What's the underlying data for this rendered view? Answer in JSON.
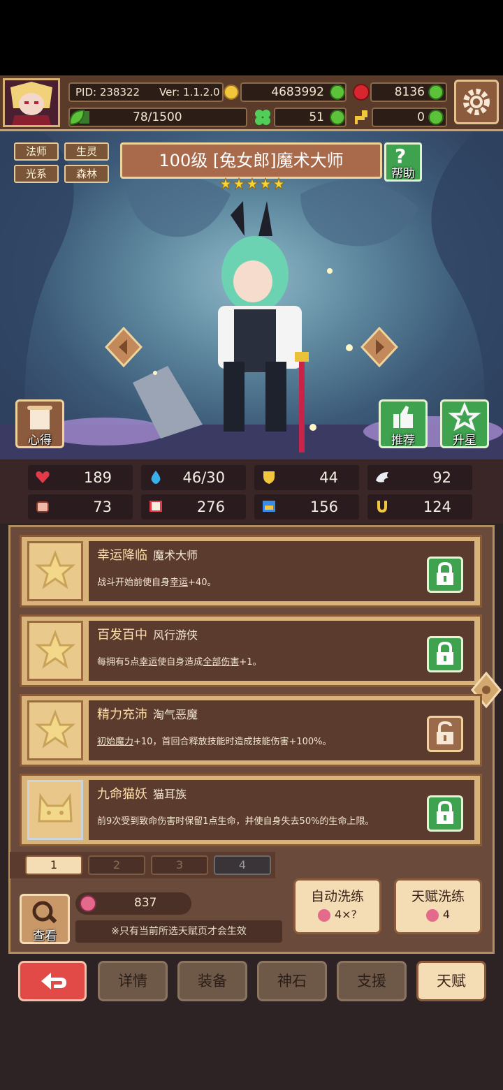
{
  "header": {
    "pid": "PID: 238322",
    "version": "Ver: 1.1.2.0",
    "gold": "4683992",
    "gems": "8136",
    "xp": "78/1500",
    "clover": "51",
    "key": "0"
  },
  "hero": {
    "tags": [
      "法师",
      "生灵",
      "光系",
      "森林"
    ],
    "title": "100级  [兔女郎]魔术大师",
    "help_label": "帮助",
    "notes_label": "心得",
    "recommend_label": "推荐",
    "upgrade_label": "升星"
  },
  "stats": [
    "189",
    "46/30",
    "44",
    "92",
    "73",
    "276",
    "156",
    "124"
  ],
  "talents": [
    {
      "name": "幸运降临",
      "sub": "魔术大师",
      "desc_a": "战斗开始前使自身",
      "desc_u1": "幸运",
      "desc_b": "+40。",
      "desc_u2": "",
      "desc_c": "",
      "lock": "locked-green"
    },
    {
      "name": "百发百中",
      "sub": "风行游侠",
      "desc_a": "每拥有5点",
      "desc_u1": "幸运",
      "desc_b": "使自身造成",
      "desc_u2": "全部伤害",
      "desc_c": "+1。",
      "lock": "locked-green"
    },
    {
      "name": "精力充沛",
      "sub": "淘气恶魔",
      "desc_a": "",
      "desc_u1": "初始魔力",
      "desc_b": "+10，首回合释放技能时造成技能伤害+100%。",
      "desc_u2": "",
      "desc_c": "",
      "lock": "unlocked-brown"
    },
    {
      "name": "九命猫妖",
      "sub": "猫耳族",
      "desc_a": "前9次受到致命伤害时保留1点生命，并使自身失去50%的生命上限。",
      "desc_u1": "",
      "desc_b": "",
      "desc_u2": "",
      "desc_c": "",
      "lock": "locked-green"
    }
  ],
  "pages": [
    "1",
    "2",
    "3",
    "4"
  ],
  "bottom": {
    "view_label": "查看",
    "fruit_count": "837",
    "notice": "※只有当前所选天赋页才会生效",
    "auto_wash": "自动洗练",
    "auto_wash_cost": "4×?",
    "talent_wash": "天赋洗练",
    "talent_wash_cost": "4"
  },
  "nav": [
    "详情",
    "装备",
    "神石",
    "支援",
    "天赋"
  ],
  "colors": {
    "green_button": "#3fa24f",
    "red_button": "#e24a47",
    "active_tab": "#f4dcb5"
  }
}
